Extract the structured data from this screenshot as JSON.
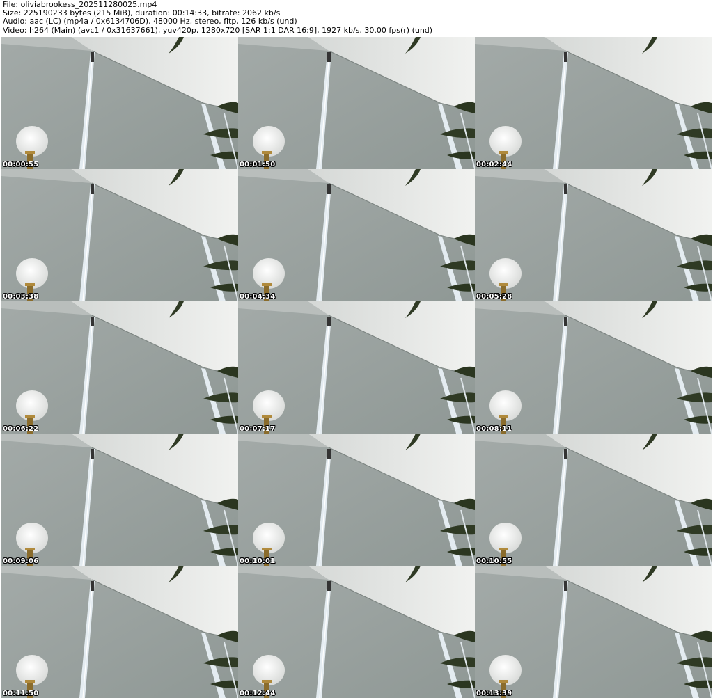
{
  "header": {
    "file_line": "File: oliviabrookess_202511280025.mp4",
    "size_line": "Size: 225190233 bytes (215 MiB), duration: 00:14:33, bitrate: 2062 kb/s",
    "audio_line": "Audio: aac (LC) (mp4a / 0x6134706D), 48000 Hz, stereo, fltp, 126 kb/s (und)",
    "video_line": "Video: h264 (Main) (avc1 / 0x31637661), yuv420p, 1280x720 [SAR 1:1 DAR 16:9], 1927 kb/s, 30.00 fps(r) (und)"
  },
  "thumbnails": [
    {
      "timestamp": "00:00:55"
    },
    {
      "timestamp": "00:01:50"
    },
    {
      "timestamp": "00:02:44"
    },
    {
      "timestamp": "00:03:38"
    },
    {
      "timestamp": "00:04:34"
    },
    {
      "timestamp": "00:05:28"
    },
    {
      "timestamp": "00:06:22"
    },
    {
      "timestamp": "00:07:17"
    },
    {
      "timestamp": "00:08:11"
    },
    {
      "timestamp": "00:09:06"
    },
    {
      "timestamp": "00:10:01"
    },
    {
      "timestamp": "00:10:55"
    },
    {
      "timestamp": "00:11:50"
    },
    {
      "timestamp": "00:12:44"
    },
    {
      "timestamp": "00:13:39"
    }
  ],
  "colors": {
    "wall": "#959e9b",
    "ceiling": "#e6e7e5",
    "light_strip": "#dfe8ee",
    "lamp": "#eeeeec",
    "leaf": "#2f3a24"
  }
}
